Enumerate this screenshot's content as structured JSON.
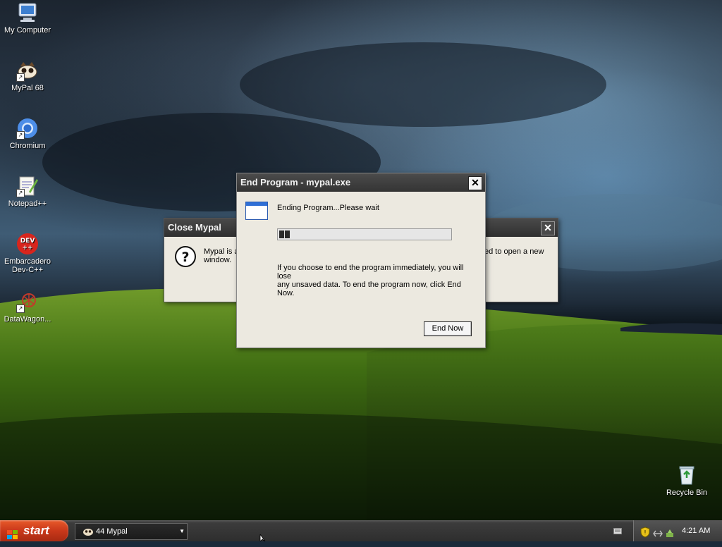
{
  "desktop": {
    "icons": [
      {
        "label": "My Computer",
        "icon": "my-computer-icon"
      },
      {
        "label": "MyPal 68",
        "icon": "mypal-icon"
      },
      {
        "label": "Chromium",
        "icon": "chromium-icon"
      },
      {
        "label": "Notepad++",
        "icon": "notepadpp-icon"
      },
      {
        "label": "Embarcadero Dev-C++",
        "icon": "devcpp-icon",
        "badge": "DEV\n++"
      },
      {
        "label": "DataWagon...",
        "icon": "datawagon-icon"
      },
      {
        "label": "Recycle Bin",
        "icon": "recycle-bin-icon"
      }
    ]
  },
  "close_mypal": {
    "title": "Close Mypal",
    "message_left": "Mypal is a",
    "message_left_line2": "window.",
    "message_right": "ed to open a new",
    "close_glyph": "✕"
  },
  "end_program": {
    "title": "End Program - mypal.exe",
    "status": "Ending Program...Please wait",
    "progress": 0.07,
    "warning_line1": "If you choose to end the program immediately, you will lose",
    "warning_line2": "any unsaved data. To end the program now, click End",
    "warning_line3": "Now.",
    "end_now_label": "End Now",
    "close_glyph": "✕"
  },
  "taskbar": {
    "start_label": "start",
    "task_label": "44 Mypal",
    "clock": "4:21 AM"
  },
  "colors": {
    "start_button": "#c9381a",
    "taskbar": "#2e2e2e",
    "dialog_bg": "#ece9e0"
  }
}
